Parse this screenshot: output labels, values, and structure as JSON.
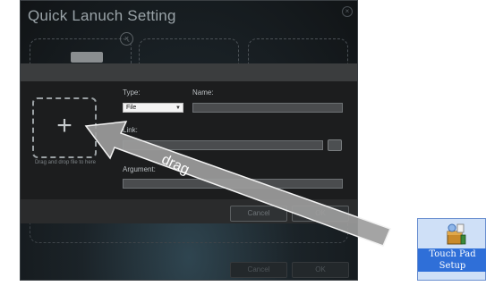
{
  "window": {
    "title": "Quick Lanuch Setting",
    "close_icon": "close-icon",
    "bg_buttons": [
      "Cancel",
      "OK"
    ]
  },
  "dialog": {
    "drop_hint": "Drag and drop file to here",
    "type_label": "Type:",
    "type_value": "File",
    "name_label": "Name:",
    "name_value": "",
    "link_label": "Link:",
    "link_value": "",
    "argument_label": "Argument:",
    "argument_value": "",
    "cancel_label": "Cancel",
    "ok_label": "OK"
  },
  "annotation": {
    "drag_label": "drag",
    "arrow_color": "#9c9c9c"
  },
  "desktop": {
    "icon_label": "Touch Pad Setup",
    "icon_name": "installer-icon",
    "selection_color": "#2f6fd8"
  }
}
